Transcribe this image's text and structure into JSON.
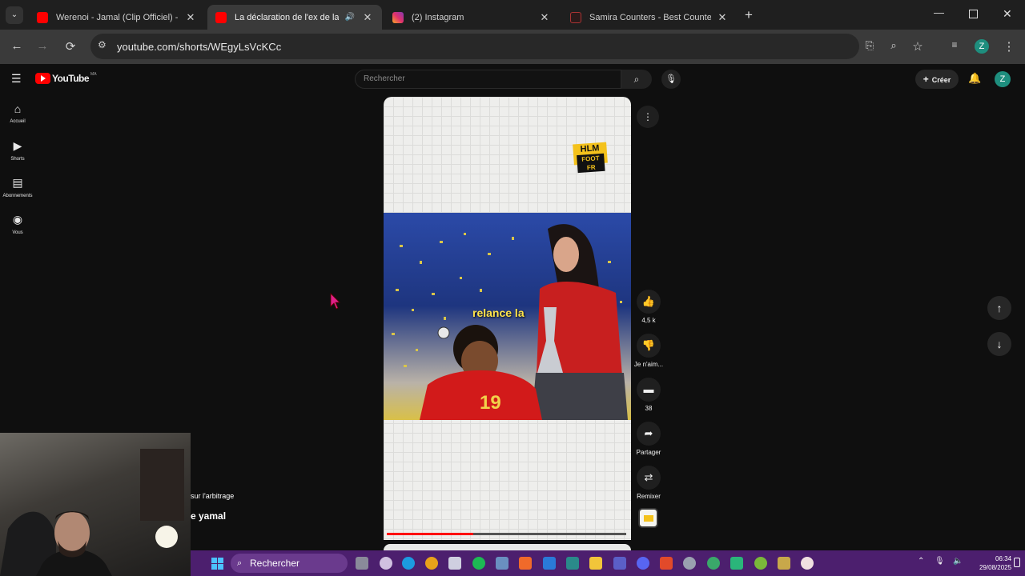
{
  "browser": {
    "tabs": [
      {
        "title": "Werenoi - Jamal (Clip Officiel) - Yo",
        "favicon": "youtube-icon",
        "active": false
      },
      {
        "title": "La déclaration de l'ex de lamin",
        "favicon": "youtube-icon",
        "active": true,
        "audio": true
      },
      {
        "title": "(2) Instagram",
        "favicon": "instagram-icon",
        "active": false
      },
      {
        "title": "Samira Counters - Best Counter Pi",
        "favicon": "web-icon",
        "active": false
      }
    ],
    "url": "youtube.com/shorts/WEgyLsVcKCc",
    "profile_initial": "Z"
  },
  "youtube": {
    "logo_text": "YouTube",
    "region": "MA",
    "search_placeholder": "Rechercher",
    "create_label": "Créer",
    "avatar_initial": "Z",
    "sidebar": [
      {
        "label": "Accueil",
        "icon": "home-icon"
      },
      {
        "label": "Shorts",
        "icon": "shorts-icon"
      },
      {
        "label": "Abonnements",
        "icon": "subscriptions-icon"
      },
      {
        "label": "Vous",
        "icon": "you-icon"
      }
    ],
    "short": {
      "watermark_top": "HLM",
      "watermark_bottom": "FOOT FR",
      "caption": "relance la",
      "jersey_number": "19",
      "progress": 0.36
    },
    "actions": {
      "like_count": "4,5 k",
      "dislike_label": "Je n'aim...",
      "comments_count": "38",
      "share_label": "Partager",
      "remix_label": "Remixer"
    }
  },
  "overlay_text": {
    "line1": "sur l'arbitrage",
    "line2": "e yamal"
  },
  "taskbar": {
    "search_label": "Rechercher",
    "time": "06:34",
    "date": "29/08/2025"
  },
  "colors": {
    "youtube_red": "#ff0000",
    "taskbar": "#4c1f6e",
    "profile": "#1e8e7e"
  }
}
